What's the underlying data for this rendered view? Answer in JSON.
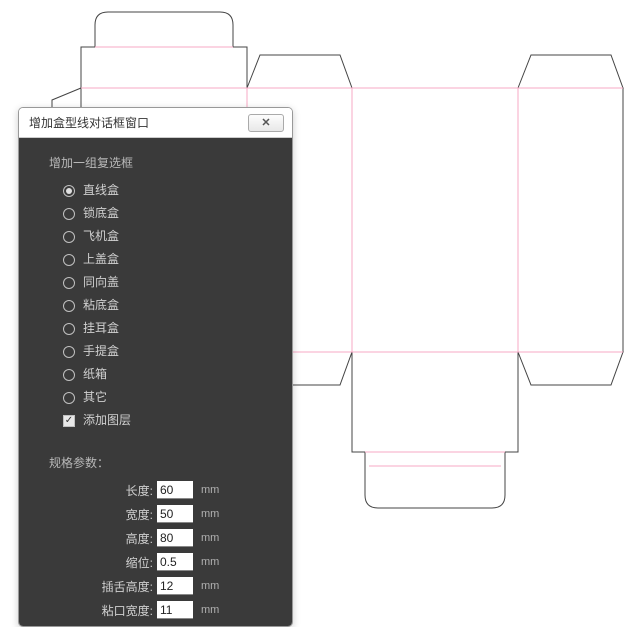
{
  "dialog": {
    "title": "增加盒型线对话框窗口",
    "close_glyph": "✕",
    "group_title": "增加一组复选框",
    "options": [
      {
        "label": "直线盒",
        "checked": true
      },
      {
        "label": "锁底盒",
        "checked": false
      },
      {
        "label": "飞机盒",
        "checked": false
      },
      {
        "label": "上盖盒",
        "checked": false
      },
      {
        "label": "同向盖",
        "checked": false
      },
      {
        "label": "粘底盒",
        "checked": false
      },
      {
        "label": "挂耳盒",
        "checked": false
      },
      {
        "label": "手提盒",
        "checked": false
      },
      {
        "label": "纸箱",
        "checked": false
      },
      {
        "label": "其它",
        "checked": false
      }
    ],
    "add_layer": {
      "label": "添加图层",
      "checked": true,
      "check_glyph": "✓"
    },
    "params_title": "规格参数：",
    "params": [
      {
        "label": "长度:",
        "value": "60",
        "unit": "mm"
      },
      {
        "label": "宽度:",
        "value": "50",
        "unit": "mm"
      },
      {
        "label": "高度:",
        "value": "80",
        "unit": "mm"
      },
      {
        "label": "缩位:",
        "value": "0.5",
        "unit": "mm"
      },
      {
        "label": "插舌高度:",
        "value": "12",
        "unit": "mm"
      },
      {
        "label": "粘口宽度:",
        "value": "11",
        "unit": "mm"
      }
    ]
  }
}
